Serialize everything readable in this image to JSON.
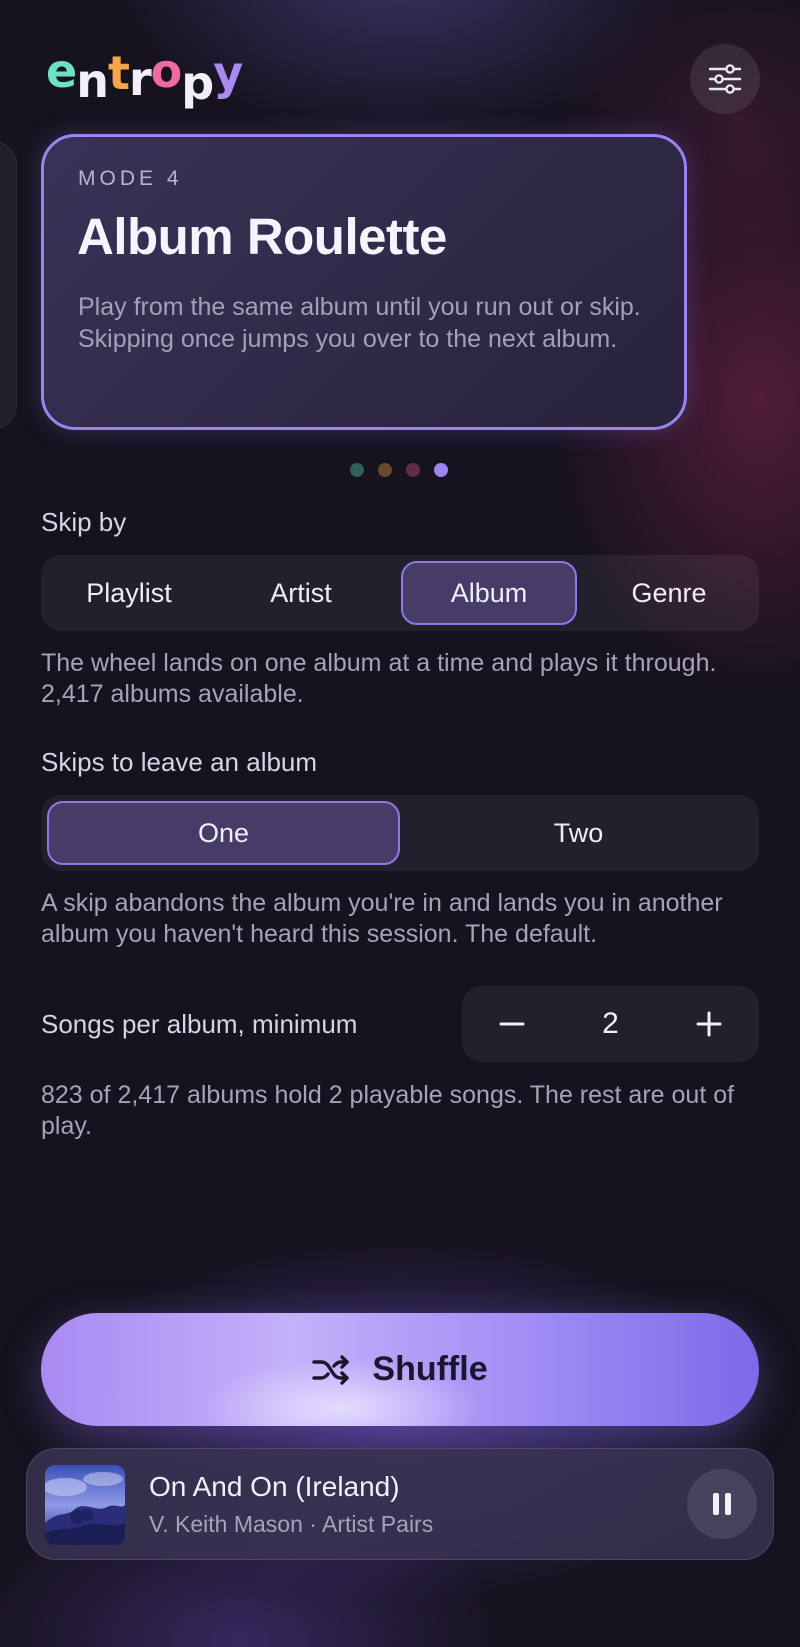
{
  "app": {
    "logo_letters": [
      "e",
      "n",
      "t",
      "r",
      "o",
      "p",
      "y"
    ]
  },
  "header": {
    "settings_icon": "sliders-icon"
  },
  "mode_card": {
    "label": "MODE 4",
    "title": "Album Roulette",
    "description": "Play from the same album until you run out or skip. Skipping once jumps you over to the next album."
  },
  "pager": {
    "total": 4,
    "active_index": 3,
    "dot_colors": [
      "#2f5f57",
      "#6a4a2e",
      "#5d2e4c",
      "#9b84f2"
    ]
  },
  "skip_by": {
    "title": "Skip by",
    "options": [
      "Playlist",
      "Artist",
      "Album",
      "Genre"
    ],
    "selected": "Album",
    "description": "The wheel lands on one album at a time and plays it through. 2,417 albums available."
  },
  "skips_to_leave": {
    "title": "Skips to leave an album",
    "options": [
      "One",
      "Two"
    ],
    "selected": "One",
    "description": "A skip abandons the album you're in and lands you in another album you haven't heard this session. The default."
  },
  "songs_per_album": {
    "label": "Songs per album, minimum",
    "value": "2",
    "decrement_icon": "minus-icon",
    "increment_icon": "plus-icon",
    "description": "823 of 2,417 albums hold 2 playable songs. The rest are out of play."
  },
  "shuffle": {
    "label": "Shuffle",
    "icon": "shuffle-icon"
  },
  "now_playing": {
    "title": "On And On (Ireland)",
    "subtitle": "V. Keith Mason · Artist Pairs",
    "pause_icon": "pause-icon"
  },
  "colors": {
    "accent": "#9b84f2",
    "background": "#17121f"
  }
}
